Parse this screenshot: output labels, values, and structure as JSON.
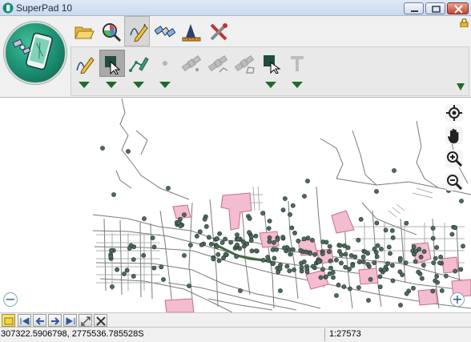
{
  "window": {
    "title": "SuperPad 10"
  },
  "ribbon": {
    "main_tools": [
      {
        "icon": "folder-open-icon"
      },
      {
        "icon": "magnifier-chart-icon"
      },
      {
        "icon": "edit-pencil-icon",
        "active": true
      },
      {
        "icon": "satellite-icon"
      },
      {
        "icon": "survey-ruler-icon"
      },
      {
        "icon": "tools-cross-icon"
      }
    ],
    "edit_tools": [
      {
        "icon": "pencil-line-icon"
      },
      {
        "icon": "select-feature-icon",
        "active": true
      },
      {
        "icon": "edit-vertex-icon"
      },
      {
        "icon": "point-dot-icon"
      },
      {
        "icon": "gps-point-icon"
      },
      {
        "icon": "gps-line-icon"
      },
      {
        "icon": "gps-polygon-icon"
      },
      {
        "icon": "polygon-edit-icon"
      },
      {
        "icon": "text-tool-icon"
      }
    ]
  },
  "map": {
    "colors": {
      "road": "#7a7a7a",
      "point_fill": "#4e6b5d",
      "polygon_fill": "#f4bcd0",
      "polygon_stroke": "#c56d8e",
      "trail": "#3f6b3f"
    },
    "tools": [
      "locate-icon",
      "pan-hand-icon",
      "zoom-in-icon",
      "zoom-out-icon"
    ],
    "zoom_minus": "−",
    "zoom_plus": "+"
  },
  "navbar": {
    "buttons": [
      "layer-icon",
      "first-icon",
      "prev-icon",
      "next-icon",
      "last-icon",
      "full-extent-icon",
      "close-extent-icon"
    ]
  },
  "status": {
    "coordinates": "307322.5906798, 2775536.785528S",
    "scale": "1:27573"
  }
}
